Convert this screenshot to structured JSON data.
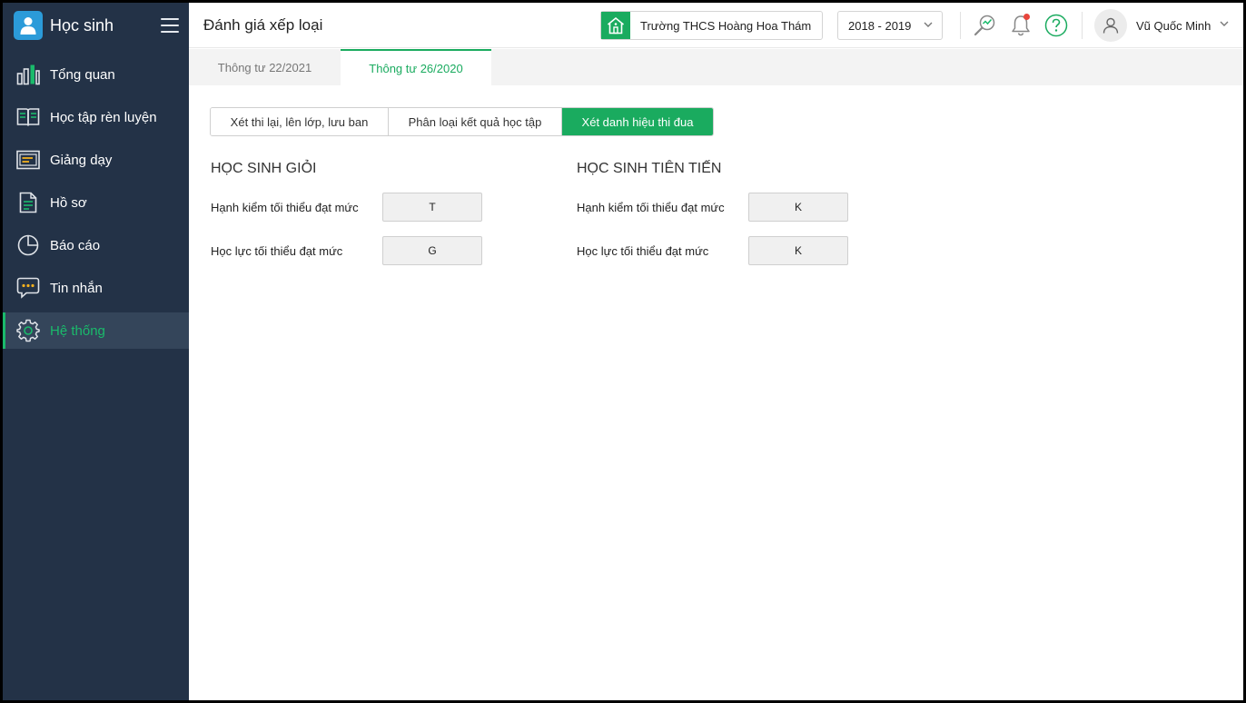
{
  "app": {
    "title": "Học sinh"
  },
  "sidebar": {
    "items": [
      {
        "label": "Tổng quan",
        "icon": "bar-chart-icon"
      },
      {
        "label": "Học tập rèn luyện",
        "icon": "book-icon"
      },
      {
        "label": "Giảng dạy",
        "icon": "board-icon"
      },
      {
        "label": "Hồ sơ",
        "icon": "document-icon"
      },
      {
        "label": "Báo cáo",
        "icon": "pie-chart-icon"
      },
      {
        "label": "Tin nhắn",
        "icon": "message-icon"
      },
      {
        "label": "Hệ thống",
        "icon": "gear-icon",
        "active": true
      }
    ]
  },
  "header": {
    "title": "Đánh giá xếp loại",
    "school": "Trường THCS Hoàng Hoa Thám",
    "year": "2018 - 2019",
    "user": "Vũ Quốc Minh"
  },
  "tabs": [
    {
      "label": "Thông tư 22/2021"
    },
    {
      "label": "Thông tư 26/2020",
      "active": true
    }
  ],
  "segments": [
    {
      "label": "Xét thi lại, lên lớp, lưu ban"
    },
    {
      "label": "Phân loại kết quả học tập"
    },
    {
      "label": "Xét danh hiệu thi đua",
      "active": true
    }
  ],
  "sections": {
    "gioi": {
      "title": "HỌC SINH GIỎI",
      "conduct_label": "Hạnh kiểm tối thiểu đạt mức",
      "conduct_value": "T",
      "academic_label": "Học lực tối thiểu đạt mức",
      "academic_value": "G"
    },
    "tien_tien": {
      "title": "HỌC SINH TIÊN TIẾN",
      "conduct_label": "Hạnh kiểm tối thiểu đạt mức",
      "conduct_value": "K",
      "academic_label": "Học lực tối thiểu đạt mức",
      "academic_value": "K"
    }
  },
  "colors": {
    "sidebar": "#233247",
    "accent": "#1aab5f",
    "active_nav": "#1aba6b"
  }
}
